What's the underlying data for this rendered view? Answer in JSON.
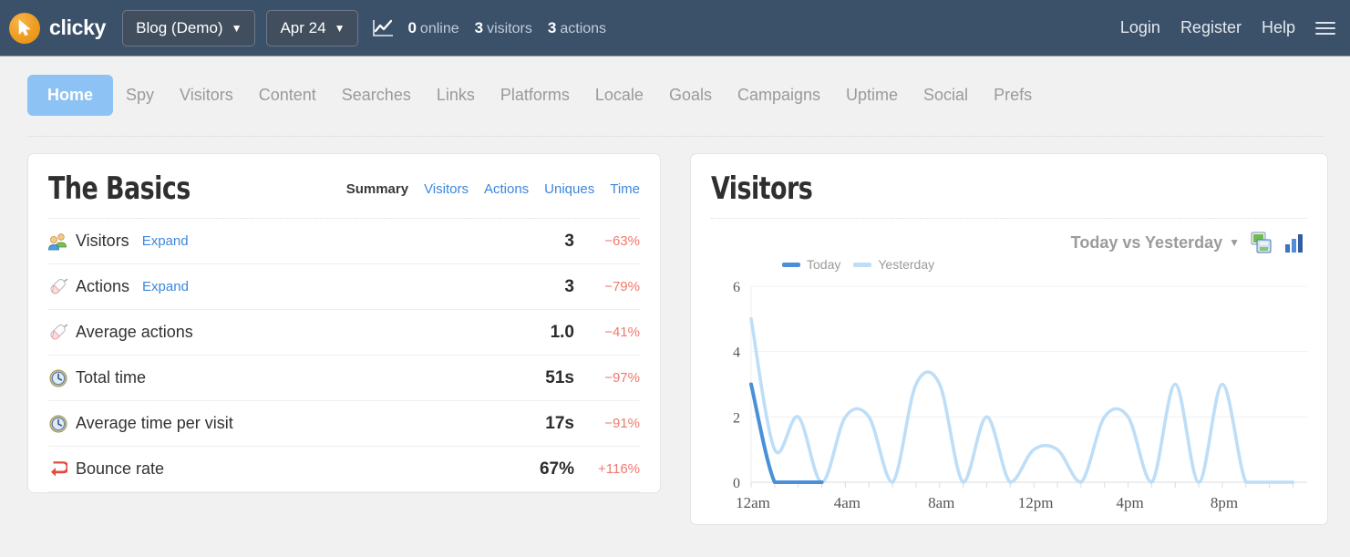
{
  "header": {
    "brand": "clicky",
    "logo_icon": "cursor-arrow-icon",
    "site_selector": {
      "label": "Blog (Demo)",
      "caret": "▼"
    },
    "date_selector": {
      "label": "Apr 24",
      "caret": "▼"
    },
    "chart_toggle_icon": "line-chart-icon",
    "live_stats": [
      {
        "value": "0",
        "unit": "online"
      },
      {
        "value": "3",
        "unit": "visitors"
      },
      {
        "value": "3",
        "unit": "actions"
      }
    ],
    "links": [
      "Login",
      "Register",
      "Help"
    ],
    "menu_icon": "hamburger-menu-icon"
  },
  "nav": {
    "tabs": [
      {
        "label": "Home",
        "active": true
      },
      {
        "label": "Spy",
        "active": false
      },
      {
        "label": "Visitors",
        "active": false
      },
      {
        "label": "Content",
        "active": false
      },
      {
        "label": "Searches",
        "active": false
      },
      {
        "label": "Links",
        "active": false
      },
      {
        "label": "Platforms",
        "active": false
      },
      {
        "label": "Locale",
        "active": false
      },
      {
        "label": "Goals",
        "active": false
      },
      {
        "label": "Campaigns",
        "active": false
      },
      {
        "label": "Uptime",
        "active": false
      },
      {
        "label": "Social",
        "active": false
      },
      {
        "label": "Prefs",
        "active": false
      }
    ]
  },
  "basics": {
    "title": "The Basics",
    "subtabs": [
      {
        "label": "Summary",
        "active": true
      },
      {
        "label": "Visitors",
        "active": false
      },
      {
        "label": "Actions",
        "active": false
      },
      {
        "label": "Uniques",
        "active": false
      },
      {
        "label": "Time",
        "active": false
      }
    ],
    "rows": [
      {
        "icon": "people-icon",
        "label": "Visitors",
        "expand": "Expand",
        "value": "3",
        "delta": "−63%",
        "delta_dir": "down"
      },
      {
        "icon": "mouse-icon",
        "label": "Actions",
        "expand": "Expand",
        "value": "3",
        "delta": "−79%",
        "delta_dir": "down"
      },
      {
        "icon": "mouse-icon",
        "label": "Average actions",
        "expand": "",
        "value": "1.0",
        "delta": "−41%",
        "delta_dir": "down"
      },
      {
        "icon": "clock-icon",
        "label": "Total time",
        "expand": "",
        "value": "51s",
        "delta": "−97%",
        "delta_dir": "down"
      },
      {
        "icon": "clock-icon",
        "label": "Average time per visit",
        "expand": "",
        "value": "17s",
        "delta": "−91%",
        "delta_dir": "down"
      },
      {
        "icon": "bounce-arrow-icon",
        "label": "Bounce rate",
        "expand": "",
        "value": "67%",
        "delta": "+116%",
        "delta_dir": "up"
      }
    ]
  },
  "visitors_panel": {
    "title": "Visitors",
    "compare_selector": {
      "label": "Today vs Yesterday",
      "caret": "▼"
    },
    "export_icon": "save-export-icon",
    "bar_chart_icon": "bar-chart-icon"
  },
  "chart_data": {
    "type": "line",
    "title": "Visitors",
    "xlabel": "",
    "ylabel": "",
    "ylim": [
      0,
      6
    ],
    "yticks": [
      0,
      2,
      4,
      6
    ],
    "grid": true,
    "legend_position": "top-left",
    "x": [
      "12am",
      "1am",
      "2am",
      "3am",
      "4am",
      "5am",
      "6am",
      "7am",
      "8am",
      "9am",
      "10am",
      "11am",
      "12pm",
      "1pm",
      "2pm",
      "3pm",
      "4pm",
      "5pm",
      "6pm",
      "7pm",
      "8pm",
      "9pm",
      "10pm",
      "11pm"
    ],
    "xtick_labels": [
      "12am",
      "4am",
      "8am",
      "12pm",
      "4pm",
      "8pm"
    ],
    "series": [
      {
        "name": "Today",
        "color": "#4a90d9",
        "values": [
          3,
          0,
          0,
          0,
          null,
          null,
          null,
          null,
          null,
          null,
          null,
          null,
          null,
          null,
          null,
          null,
          null,
          null,
          null,
          null,
          null,
          null,
          null,
          null
        ]
      },
      {
        "name": "Yesterday",
        "color": "#bedef7",
        "values": [
          5,
          1,
          2,
          0,
          2,
          2,
          0,
          3,
          3,
          0,
          2,
          0,
          1,
          1,
          0,
          2,
          2,
          0,
          3,
          0,
          3,
          0,
          0,
          0
        ]
      }
    ]
  }
}
